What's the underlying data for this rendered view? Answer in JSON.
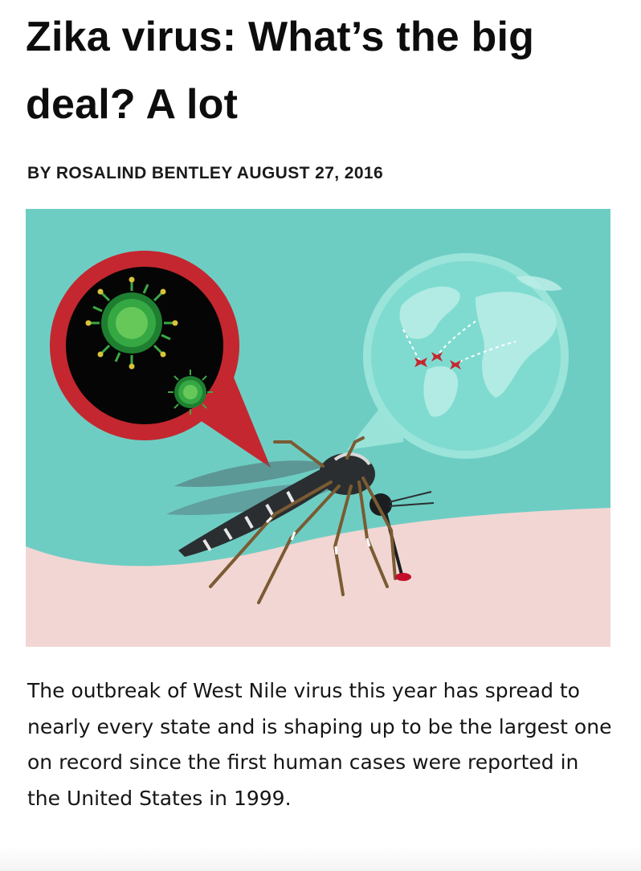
{
  "article": {
    "headline": "Zika virus: What’s the big deal? A lot",
    "byline": "BY ROSALIND BENTLEY AUGUST 27, 2016",
    "body": "The outbreak of West Nile virus this year has spread to nearly every state and is shaping up to be the largest one on record since the first human cases were reported in the United States in 1999."
  },
  "illustration": {
    "subject": "mosquito-biting-skin",
    "elements": [
      "virus-speech-bubble",
      "globe-speech-bubble",
      "airplane-icons",
      "blood-drop"
    ],
    "colors": {
      "sky": "#6ecdc3",
      "skin": "#f2d6d3",
      "virus_bubble_border": "#c4272f",
      "virus_bubble_fill": "#050505",
      "virus_green": "#35a843",
      "globe_bubble": "#9be4da",
      "airplanes": "#c4272f",
      "blood": "#c40f2a"
    }
  }
}
